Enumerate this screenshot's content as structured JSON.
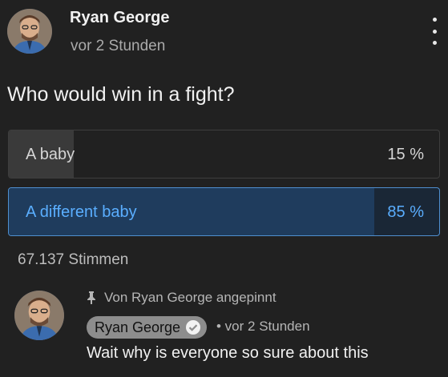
{
  "post": {
    "author": "Ryan George",
    "time": "vor 2 Stunden",
    "question": "Who would win in a fight?"
  },
  "poll": {
    "options": [
      {
        "label": "A baby",
        "percent_label": "15 %",
        "percent": 15,
        "selected": false
      },
      {
        "label": "A different baby",
        "percent_label": "85 %",
        "percent": 85,
        "selected": true
      }
    ],
    "votes": "67.137 Stimmen"
  },
  "comment": {
    "pinned_text": "Von Ryan George angepinnt",
    "author": "Ryan George",
    "time": "• vor 2 Stunden",
    "text": "Wait why is everyone so sure about this"
  },
  "icons": {
    "menu": "more-vertical-icon",
    "pin": "pin-icon",
    "verified": "check-circle-icon"
  },
  "colors": {
    "background": "#212121",
    "accent": "#5aaeff",
    "selected_fill": "#1f3c5d",
    "option_fill": "#3a3a3a"
  }
}
